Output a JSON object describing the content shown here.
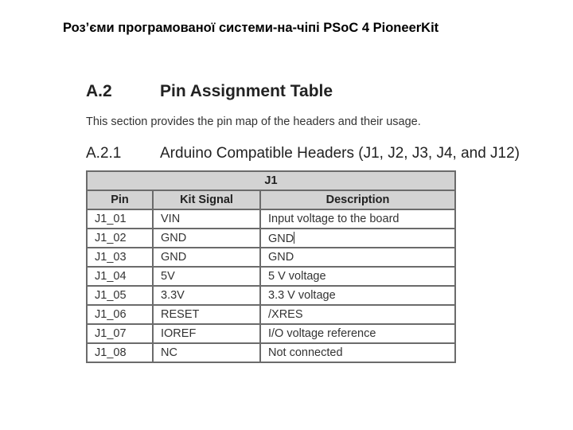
{
  "slide_title": "Роз’єми програмованої системи-на-чіпі PSoC 4 PioneerKit",
  "document": {
    "section": {
      "number": "A.2",
      "title": "Pin Assignment Table"
    },
    "intro": "This section provides the pin map of the headers and their usage.",
    "subsection": {
      "number": "A.2.1",
      "title": "Arduino Compatible Headers (J1, J2, J3, J4, and J12)"
    },
    "table": {
      "caption": "J1",
      "headers": [
        "Pin",
        "Kit Signal",
        "Description"
      ],
      "rows": [
        [
          "J1_01",
          "VIN",
          "Input voltage to the board"
        ],
        [
          "J1_02",
          "GND",
          "GND"
        ],
        [
          "J1_03",
          "GND",
          "GND"
        ],
        [
          "J1_04",
          "5V",
          "5 V voltage"
        ],
        [
          "J1_05",
          "3.3V",
          "3.3 V voltage"
        ],
        [
          "J1_06",
          "RESET",
          "/XRES"
        ],
        [
          "J1_07",
          "IOREF",
          "I/O voltage reference"
        ],
        [
          "J1_08",
          "NC",
          "Not connected"
        ]
      ]
    }
  }
}
